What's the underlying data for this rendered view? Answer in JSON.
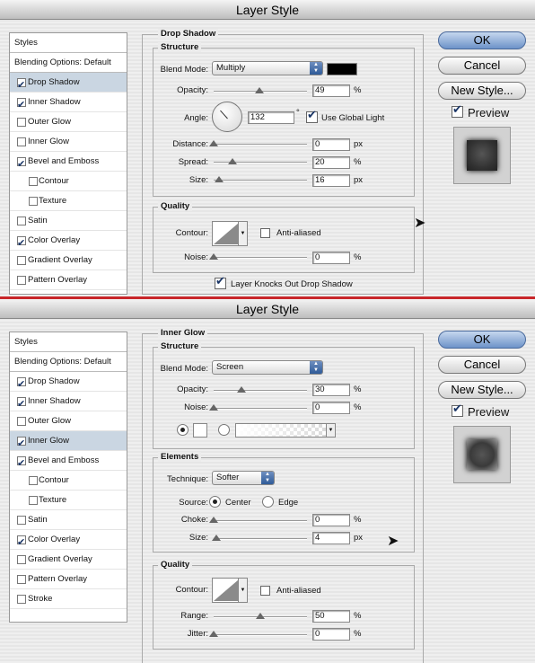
{
  "dialog1": {
    "title": "Layer Style",
    "styles_list": [
      {
        "label": "Styles",
        "kind": "header"
      },
      {
        "label": "Blending Options: Default",
        "kind": "blend"
      },
      {
        "label": "Drop Shadow",
        "checked": true,
        "selected": true
      },
      {
        "label": "Inner Shadow",
        "checked": true
      },
      {
        "label": "Outer Glow",
        "checked": false
      },
      {
        "label": "Inner Glow",
        "checked": false
      },
      {
        "label": "Bevel and Emboss",
        "checked": true
      },
      {
        "label": "Contour",
        "checked": false,
        "sub": true
      },
      {
        "label": "Texture",
        "checked": false,
        "sub": true
      },
      {
        "label": "Satin",
        "checked": false
      },
      {
        "label": "Color Overlay",
        "checked": true
      },
      {
        "label": "Gradient Overlay",
        "checked": false
      },
      {
        "label": "Pattern Overlay",
        "checked": false
      }
    ],
    "section_title": "Drop Shadow",
    "structure": {
      "title": "Structure",
      "blend_mode_label": "Blend Mode:",
      "blend_mode_value": "Multiply",
      "shadow_color": "#000000",
      "opacity_label": "Opacity:",
      "opacity_value": "49",
      "opacity_unit": "%",
      "opacity_level": 0.49,
      "angle_label": "Angle:",
      "angle_value": "132",
      "angle_unit": "°",
      "use_global_light_label": "Use Global Light",
      "use_global_light_checked": true,
      "distance_label": "Distance:",
      "distance_value": "0",
      "distance_unit": "px",
      "distance_level": 0.0,
      "spread_label": "Spread:",
      "spread_value": "20",
      "spread_unit": "%",
      "spread_level": 0.2,
      "size_label": "Size:",
      "size_value": "16",
      "size_unit": "px",
      "size_level": 0.06
    },
    "quality": {
      "title": "Quality",
      "contour_label": "Contour:",
      "anti_aliased_label": "Anti-aliased",
      "anti_aliased_checked": false,
      "noise_label": "Noise:",
      "noise_value": "0",
      "noise_unit": "%",
      "noise_level": 0.0
    },
    "knockout_label": "Layer Knocks Out Drop Shadow",
    "knockout_checked": true,
    "buttons": {
      "ok": "OK",
      "cancel": "Cancel",
      "new_style": "New Style..."
    },
    "preview_label": "Preview",
    "preview_checked": true
  },
  "dialog2": {
    "title": "Layer Style",
    "styles_list": [
      {
        "label": "Styles",
        "kind": "header"
      },
      {
        "label": "Blending Options: Default",
        "kind": "blend"
      },
      {
        "label": "Drop Shadow",
        "checked": true
      },
      {
        "label": "Inner Shadow",
        "checked": true
      },
      {
        "label": "Outer Glow",
        "checked": false
      },
      {
        "label": "Inner Glow",
        "checked": true,
        "selected": true
      },
      {
        "label": "Bevel and Emboss",
        "checked": true
      },
      {
        "label": "Contour",
        "checked": false,
        "sub": true
      },
      {
        "label": "Texture",
        "checked": false,
        "sub": true
      },
      {
        "label": "Satin",
        "checked": false
      },
      {
        "label": "Color Overlay",
        "checked": true
      },
      {
        "label": "Gradient Overlay",
        "checked": false
      },
      {
        "label": "Pattern Overlay",
        "checked": false
      },
      {
        "label": "Stroke",
        "checked": false
      }
    ],
    "section_title": "Inner Glow",
    "structure": {
      "title": "Structure",
      "blend_mode_label": "Blend Mode:",
      "blend_mode_value": "Screen",
      "opacity_label": "Opacity:",
      "opacity_value": "30",
      "opacity_unit": "%",
      "opacity_level": 0.3,
      "noise_label": "Noise:",
      "noise_value": "0",
      "noise_unit": "%",
      "noise_level": 0.0,
      "glow_color": "#ffffff"
    },
    "elements": {
      "title": "Elements",
      "technique_label": "Technique:",
      "technique_value": "Softer",
      "source_label": "Source:",
      "center_label": "Center",
      "edge_label": "Edge",
      "choke_label": "Choke:",
      "choke_value": "0",
      "choke_unit": "%",
      "choke_level": 0.0,
      "size_label": "Size:",
      "size_value": "4",
      "size_unit": "px",
      "size_level": 0.03
    },
    "quality": {
      "title": "Quality",
      "contour_label": "Contour:",
      "anti_aliased_label": "Anti-aliased",
      "anti_aliased_checked": false,
      "range_label": "Range:",
      "range_value": "50",
      "range_unit": "%",
      "range_level": 0.5,
      "jitter_label": "Jitter:",
      "jitter_value": "0",
      "jitter_unit": "%",
      "jitter_level": 0.0
    },
    "buttons": {
      "ok": "OK",
      "cancel": "Cancel",
      "new_style": "New Style..."
    },
    "preview_label": "Preview",
    "preview_checked": true
  }
}
